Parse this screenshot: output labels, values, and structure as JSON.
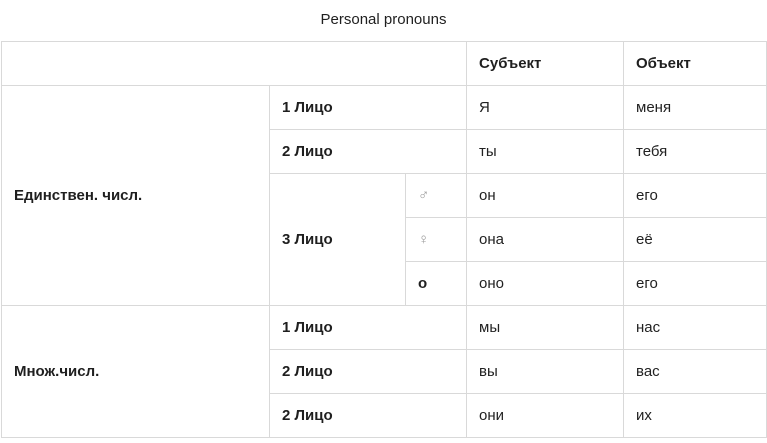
{
  "caption": "Personal pronouns",
  "headers": {
    "subject": "Субъект",
    "object": "Объект"
  },
  "singular": {
    "label": "Единствен. числ.",
    "person1": {
      "label": "1 Лицо",
      "subject": "Я",
      "object": "меня"
    },
    "person2": {
      "label": "2 Лицо",
      "subject": "ты",
      "object": "тебя"
    },
    "person3": {
      "label": "3 Лицо",
      "masculine": {
        "symbol": "♂",
        "subject": "он",
        "object": "его"
      },
      "feminine": {
        "symbol": "♀",
        "subject": "она",
        "object": "её"
      },
      "neuter": {
        "symbol": "o",
        "subject": "оно",
        "object": "его"
      }
    }
  },
  "plural": {
    "label": "Множ.числ.",
    "rows": [
      {
        "label": "1 Лицо",
        "subject": "мы",
        "object": "нас"
      },
      {
        "label": "2 Лицо",
        "subject": "вы",
        "object": "вас"
      },
      {
        "label": "2 Лицо",
        "subject": "они",
        "object": "их"
      }
    ]
  }
}
